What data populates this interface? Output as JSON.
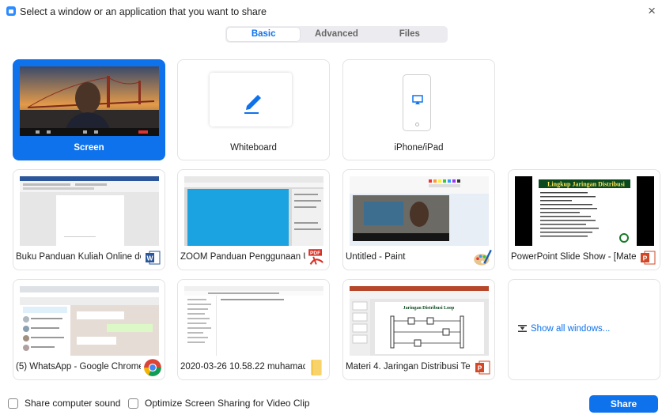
{
  "window": {
    "title": "Select a window or an application that you want to share",
    "close_glyph": "×"
  },
  "tabs": [
    {
      "label": "Basic",
      "active": true
    },
    {
      "label": "Advanced",
      "active": false
    },
    {
      "label": "Files",
      "active": false
    }
  ],
  "tiles": {
    "screen": {
      "label": "Screen",
      "selected": true
    },
    "whiteboard": {
      "label": "Whiteboard",
      "icon": "pen-icon"
    },
    "iphone": {
      "label": "iPhone/iPad",
      "icon": "airplay-icon"
    },
    "word": {
      "label": "Buku Panduan Kuliah Online deng...",
      "app_icon": "word-icon"
    },
    "pdf": {
      "label": "ZOOM Panduan Penggunaan Unt...",
      "app_icon": "pdf-icon",
      "badge_text": "PDF"
    },
    "paint": {
      "label": "Untitled - Paint",
      "app_icon": "paint-palette-icon"
    },
    "ppt_show": {
      "label": "PowerPoint Slide Show - [Materi ...",
      "app_icon": "powerpoint-icon",
      "slide_title": "Lingkup Jaringan Distribusi"
    },
    "whatsapp": {
      "label": "(5) WhatsApp - Google Chrome",
      "app_icon": "chrome-icon"
    },
    "folder": {
      "label": "2020-03-26 10.58.22 muhamad ...",
      "app_icon": "folder-icon"
    },
    "ppt_edit": {
      "label": "Materi 4. Jaringan Distribusi Tena...",
      "app_icon": "powerpoint-icon",
      "slide_title": "Jaringan Distribusi Loop"
    },
    "show_all": {
      "label": "Show all windows..."
    }
  },
  "footer": {
    "share_sound": "Share computer sound",
    "optimize_video": "Optimize Screen Sharing for Video Clip",
    "share_button": "Share"
  },
  "colors": {
    "accent": "#0e72ed",
    "tile_border": "#e3e3e3",
    "word_blue": "#2b579a",
    "pdf_red": "#d93025",
    "ppt_orange": "#d24726"
  }
}
